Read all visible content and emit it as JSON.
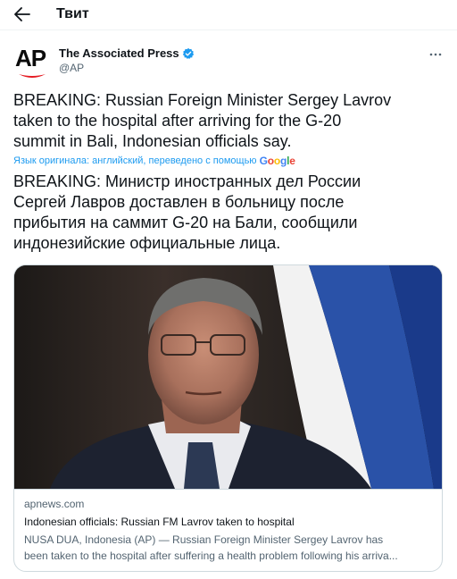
{
  "header": {
    "title": "Твит"
  },
  "author": {
    "name": "The Associated Press",
    "handle": "@AP",
    "avatar_text": "AP"
  },
  "tweet": {
    "text_en_lines": [
      "BREAKING: Russian Foreign Minister Sergey Lavrov",
      "taken to the hospital after arriving for the G-20",
      "summit in Bali, Indonesian officials say."
    ],
    "translation_note": "Язык оригинала: английский, переведено с помощью",
    "translation_provider": "Google",
    "text_ru_lines": [
      "BREAKING: Министр иностранных дел России",
      "Сергей Лавров доставлен в больницу после",
      "прибытия на саммит G-20 на Бали, сообщили",
      "индонезийские официальные лица."
    ]
  },
  "card": {
    "domain": "apnews.com",
    "title": "Indonesian officials: Russian FM Lavrov taken to hospital",
    "description_lines": [
      "NUSA DUA, Indonesia (AP) — Russian Foreign Minister Sergey Lavrov has",
      "been taken to the hospital after suffering a health problem following his arriva..."
    ]
  },
  "colors": {
    "accent": "#1d9bf0",
    "text_primary": "#0f1419",
    "text_secondary": "#536471",
    "border": "#cfd9de",
    "verified": "#1d9bf0",
    "ap_red": "#e51b23"
  },
  "icons": {
    "back": "arrow-left-icon",
    "verified": "verified-badge-icon",
    "more": "more-dots-icon"
  }
}
